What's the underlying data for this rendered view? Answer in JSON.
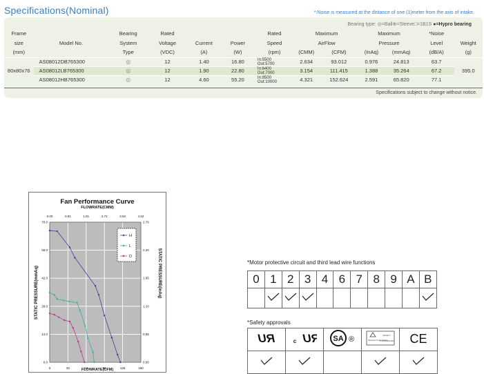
{
  "header": {
    "title": "Specifications(Nominal)",
    "noise_note": "*:Noise is measured at the distance of one (1)meter from the axis of intake.",
    "bearing_type_label": "Bearing type:",
    "bearing_type_legend": "◎=Ball⊕=Sleeve□=1B1S",
    "bearing_type_hypro": "●=Hypro bearing"
  },
  "table": {
    "headers": {
      "frame": [
        "Frame",
        "size",
        "(mm)"
      ],
      "model": "Model No.",
      "bearing": [
        "Bearing",
        "System",
        "Type"
      ],
      "voltage": [
        "Rated",
        "Voltage",
        "(VDC)"
      ],
      "current": [
        "Current",
        "(A)"
      ],
      "power": [
        "Power",
        "(W)"
      ],
      "speed": [
        "Rated",
        "Speed",
        "(rpm)"
      ],
      "airflow": [
        "Maximum",
        "AirFlow",
        "(CMM)",
        "(CFM)"
      ],
      "pressure": [
        "Maximum",
        "Pressure",
        "(InAq)",
        "(mmAq)"
      ],
      "noise": [
        "*Noise",
        "Level",
        "(dB/A)"
      ],
      "weight": [
        "Weight",
        "(g)"
      ]
    },
    "frame_size": "80x80x76",
    "weight_value": "395.0",
    "rows": [
      {
        "model": "AS08012DB765300",
        "bearing": "◎",
        "voltage": "12",
        "current": "1.40",
        "power": "16.80",
        "speed_in": "In:5500",
        "speed_out": "Out:5700",
        "cmm": "2.634",
        "cfm": "93.012",
        "inaq": "0.976",
        "mmaq": "24.813",
        "noise": "63.7"
      },
      {
        "model": "AS08012LB765300",
        "bearing": "◎",
        "voltage": "12",
        "current": "1.90",
        "power": "22.80",
        "speed_in": "In:6400",
        "speed_out": "Out:7000",
        "cmm": "3.154",
        "cfm": "111.415",
        "inaq": "1.388",
        "mmaq": "35.264",
        "noise": "67.2"
      },
      {
        "model": "AS08012HB765300",
        "bearing": "◎",
        "voltage": "12",
        "current": "4.60",
        "power": "55.20",
        "speed_in": "In:8500",
        "speed_out": "Out:10000",
        "cmm": "4.321",
        "cfm": "152.624",
        "inaq": "2.591",
        "mmaq": "65.820",
        "noise": "77.1"
      }
    ],
    "footnote": "Specifications subject to change without notice."
  },
  "chart_data": {
    "type": "line",
    "title": "Fan Performance Curve",
    "top_axis_label": "FLOWRATE(CMM)",
    "top_ticks": [
      "0.00",
      "0.91",
      "1.81",
      "2.72",
      "3.62",
      "4.53"
    ],
    "xlabel": "FLOWRATE(CFM)",
    "x_ticks": [
      "0",
      "32",
      "64",
      "96",
      "128",
      "160"
    ],
    "ylabel": "STATIC PRESSURE(mmAq)",
    "y_ticks": [
      "0.0",
      "14.0",
      "28.0",
      "42.0",
      "56.0",
      "70.0"
    ],
    "ylabel_right": "STATIC PRESSURE(inAq)",
    "y_right_ticks": [
      "0.00",
      "0.55",
      "1.10",
      "1.65",
      "2.20",
      "2.76"
    ],
    "xlim": [
      0,
      160
    ],
    "ylim": [
      0,
      70
    ],
    "grid": true,
    "legend_position": "top-right",
    "series": [
      {
        "name": "H",
        "color": "#3b3f9c",
        "x": [
          0,
          13,
          35,
          44,
          80,
          86,
          96,
          109,
          119,
          124
        ],
        "y": [
          65.8,
          65.5,
          57.5,
          52.3,
          38.2,
          33.7,
          23.4,
          12.3,
          3.8,
          0
        ]
      },
      {
        "name": "L",
        "color": "#39b09d",
        "x": [
          0,
          8,
          13,
          24,
          34,
          48,
          53,
          62,
          67,
          76,
          78
        ],
        "y": [
          34.8,
          33.7,
          31.6,
          30.9,
          30.4,
          29.8,
          26.0,
          18.2,
          12.0,
          5.0,
          0
        ]
      },
      {
        "name": "D",
        "color": "#b03a8f",
        "x": [
          0,
          8,
          16,
          26,
          35,
          41,
          50,
          55,
          61
        ],
        "y": [
          24.4,
          23.8,
          22.5,
          21.0,
          20.4,
          17.2,
          10.3,
          5.4,
          0
        ]
      }
    ]
  },
  "wire_functions": {
    "title": "*Motor protective circuit and third lead wire functions",
    "codes": [
      "0",
      "1",
      "2",
      "3",
      "4",
      "6",
      "7",
      "8",
      "9",
      "A",
      "B"
    ],
    "checked": [
      false,
      true,
      true,
      true,
      false,
      false,
      false,
      false,
      false,
      false,
      true
    ]
  },
  "safety": {
    "title": "*Safety approvals",
    "marks": [
      "UR",
      "cUR",
      "CSA",
      "TUV",
      "CE"
    ],
    "logo_text": {
      "ur": "RU",
      "cur_c": "c",
      "csa": "SA",
      "registered": "®",
      "tuv_top": "SAFETY",
      "tuv_bottom": "TYPE APPROVED",
      "tuv_left": "Rheinland Product Safety",
      "ce": "CE"
    },
    "checked": [
      true,
      true,
      false,
      true,
      true
    ]
  }
}
